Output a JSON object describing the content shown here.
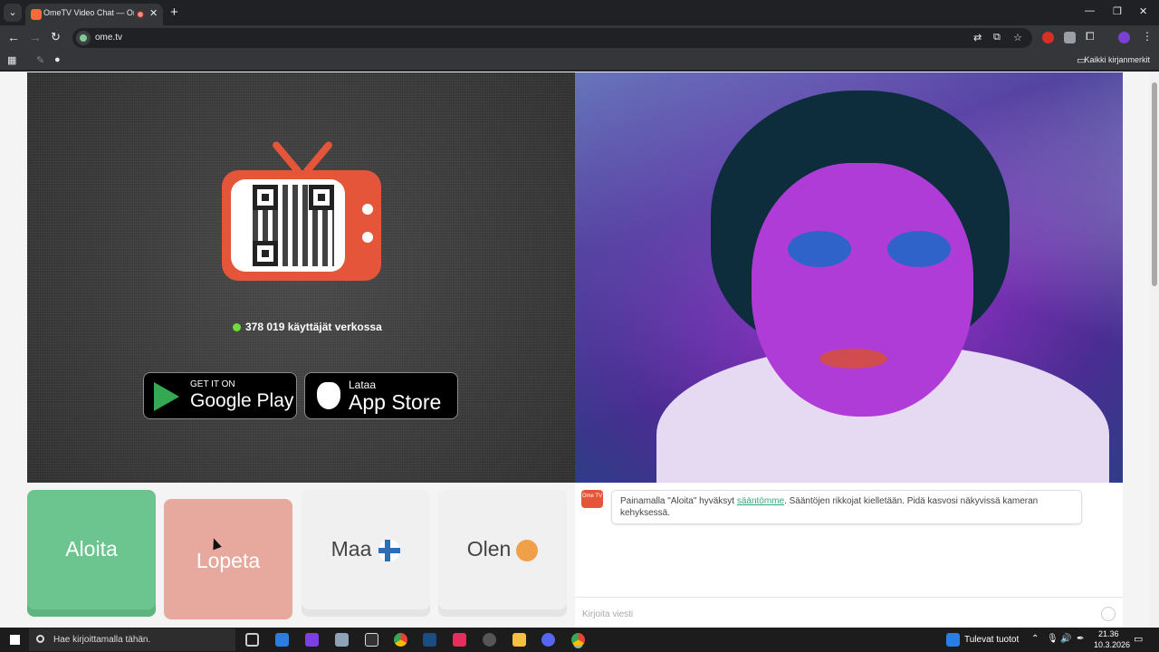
{
  "browser": {
    "tab_title": "OmeTV Video Chat — Ome",
    "url": "ome.tv",
    "bookmarks_label": "Kaikki kirjanmerkit"
  },
  "left_panel": {
    "users_online": "378 019 käyttäjät verkossa",
    "google_play_small": "GET IT ON",
    "google_play_big": "Google Play",
    "app_store_small": "Lataa",
    "app_store_big": "App Store"
  },
  "controls": {
    "start": "Aloita",
    "stop": "Lopeta",
    "country": "Maa",
    "gender": "Olen"
  },
  "chat": {
    "logo_text": "Ome TV",
    "message_prefix": "Painamalla \"Aloita\" hyväksyt ",
    "message_link": "sääntömme",
    "message_suffix": ". Sääntöjen rikkojat kielletään. Pidä kasvosi näkyvissä kameran kehyksessä.",
    "input_placeholder": "Kirjoita viesti"
  },
  "taskbar": {
    "search_placeholder": "Hae kirjoittamalla tähän.",
    "news_label": "Tulevat tuotot",
    "time": "21.36",
    "date": "10.3.2026"
  },
  "colors": {
    "accent_green": "#6cc58f",
    "accent_red": "#e4553a"
  }
}
